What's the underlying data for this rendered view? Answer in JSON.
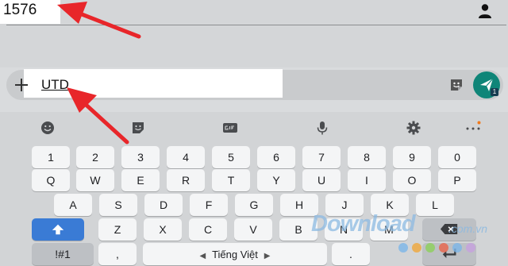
{
  "recipient": {
    "value": "1576"
  },
  "compose": {
    "text": "UTD",
    "send_badge": "1"
  },
  "keyboard": {
    "number_row": [
      "1",
      "2",
      "3",
      "4",
      "5",
      "6",
      "7",
      "8",
      "9",
      "0"
    ],
    "row1": [
      "Q",
      "W",
      "E",
      "R",
      "T",
      "Y",
      "U",
      "I",
      "O",
      "P"
    ],
    "row2": [
      "A",
      "S",
      "D",
      "F",
      "G",
      "H",
      "J",
      "K",
      "L"
    ],
    "row3": [
      "Z",
      "X",
      "C",
      "V",
      "B",
      "N",
      "M"
    ],
    "symbols_key": "!#1",
    "comma_key": ",",
    "space_label": "Tiếng Việt",
    "period_key": "."
  },
  "watermark": {
    "text": "Download",
    "tld": ".com.vn"
  },
  "colors": {
    "send_button": "#0f8578",
    "shift_key": "#3a7bd5",
    "arrow": "#e8262a"
  }
}
